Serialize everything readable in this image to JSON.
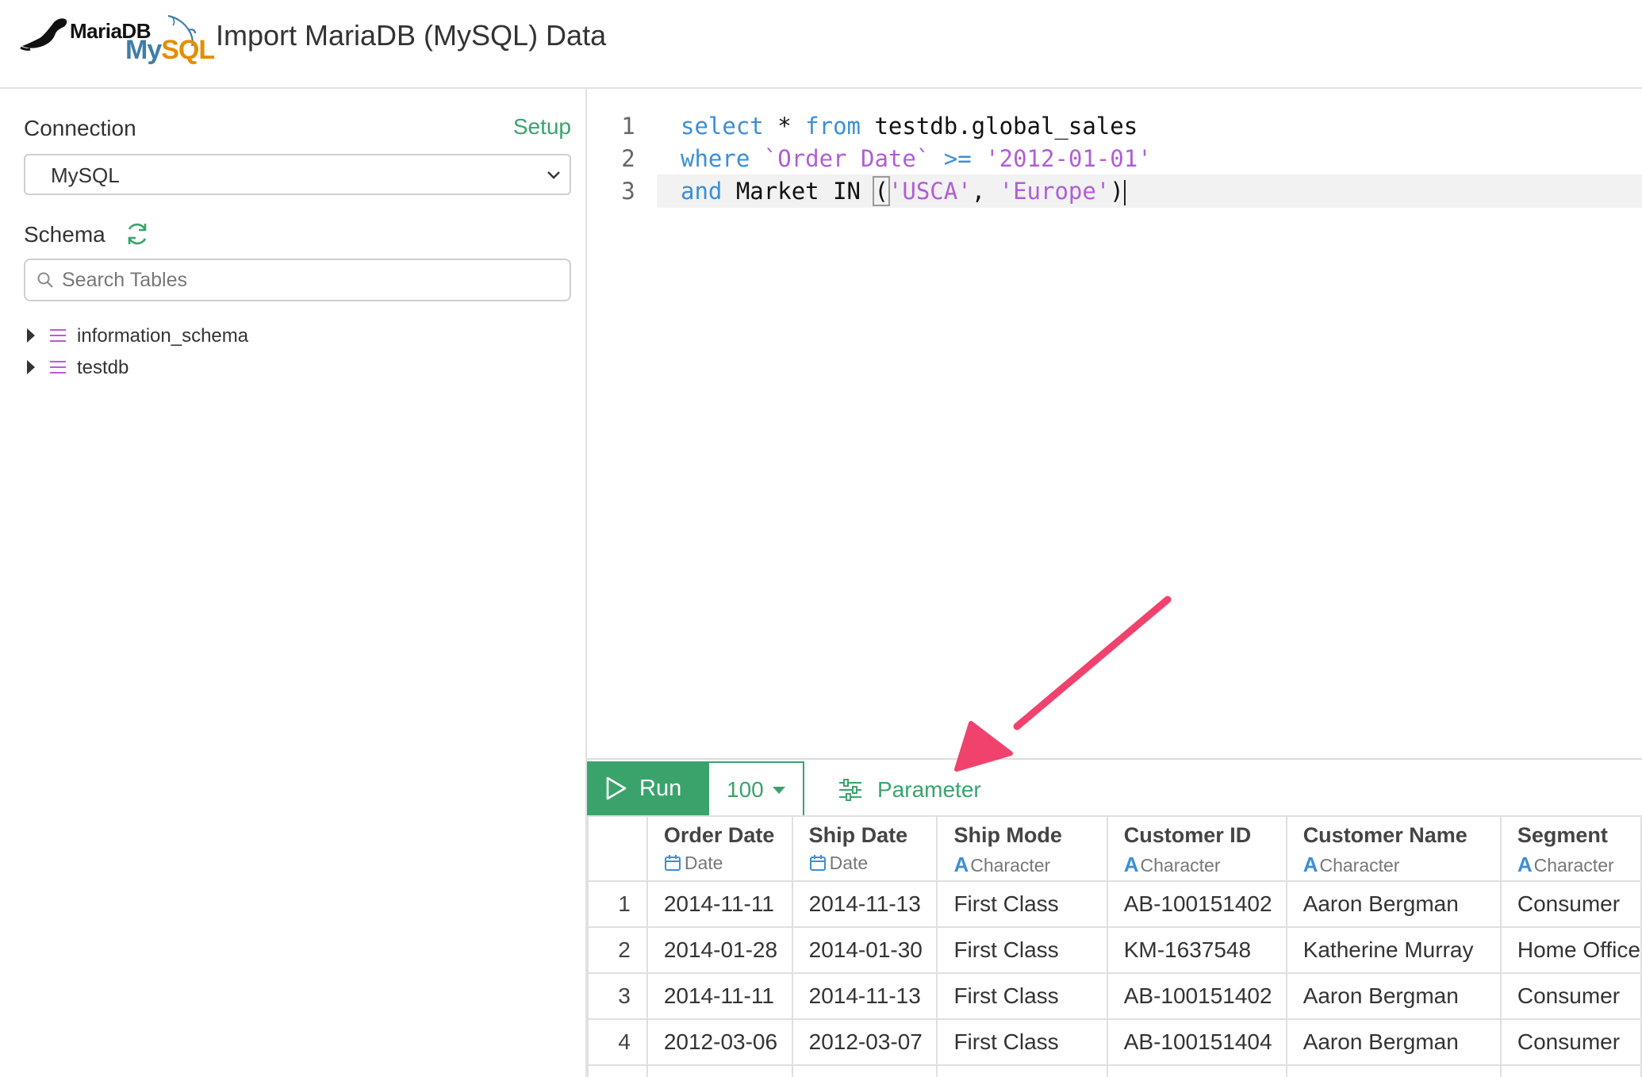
{
  "header": {
    "logo_mariadb": "MariaDB",
    "logo_mysql_my": "My",
    "logo_mysql_sql": "SQL",
    "title": "Import MariaDB (MySQL) Data"
  },
  "sidebar": {
    "connection_label": "Connection",
    "setup_label": "Setup",
    "connection_value": "MySQL",
    "schema_label": "Schema",
    "search_placeholder": "Search Tables",
    "tree": [
      {
        "name": "information_schema",
        "icon": "database-icon"
      },
      {
        "name": "testdb",
        "icon": "database-icon"
      }
    ]
  },
  "editor": {
    "lines": [
      {
        "number": "1",
        "tokens": [
          "select",
          " * ",
          "from",
          " testdb.global_sales"
        ]
      },
      {
        "number": "2",
        "tokens": [
          "where",
          " ",
          "`Order Date`",
          " ",
          ">=",
          " ",
          "'2012-01-01'"
        ]
      },
      {
        "number": "3",
        "tokens": [
          "and",
          " Market IN ",
          "(",
          "'USCA'",
          ", ",
          "'Europe'",
          ")"
        ]
      }
    ]
  },
  "toolbar": {
    "run_label": "Run",
    "limit_value": "100",
    "parameter_label": "Parameter"
  },
  "table": {
    "columns": [
      {
        "name": "Order Date",
        "type": "Date",
        "type_icon": "calendar-icon"
      },
      {
        "name": "Ship Date",
        "type": "Date",
        "type_icon": "calendar-icon"
      },
      {
        "name": "Ship Mode",
        "type": "Character",
        "type_icon": "A"
      },
      {
        "name": "Customer ID",
        "type": "Character",
        "type_icon": "A"
      },
      {
        "name": "Customer Name",
        "type": "Character",
        "type_icon": "A"
      },
      {
        "name": "Segment",
        "type": "Character",
        "type_icon": "A"
      }
    ],
    "rows": [
      {
        "n": "1",
        "cells": [
          "2014-11-11",
          "2014-11-13",
          "First Class",
          "AB-100151402",
          "Aaron Bergman",
          "Consumer"
        ]
      },
      {
        "n": "2",
        "cells": [
          "2014-01-28",
          "2014-01-30",
          "First Class",
          "KM-1637548",
          "Katherine Murray",
          "Home Office"
        ]
      },
      {
        "n": "3",
        "cells": [
          "2014-11-11",
          "2014-11-13",
          "First Class",
          "AB-100151402",
          "Aaron Bergman",
          "Consumer"
        ]
      },
      {
        "n": "4",
        "cells": [
          "2012-03-06",
          "2012-03-07",
          "First Class",
          "AB-100151404",
          "Aaron Bergman",
          "Consumer"
        ]
      }
    ]
  },
  "colors": {
    "accent_green": "#3aa36c",
    "keyword_blue": "#3b8fd6",
    "string_purple": "#b05ed6",
    "annotation_arrow": "#f0426d"
  }
}
